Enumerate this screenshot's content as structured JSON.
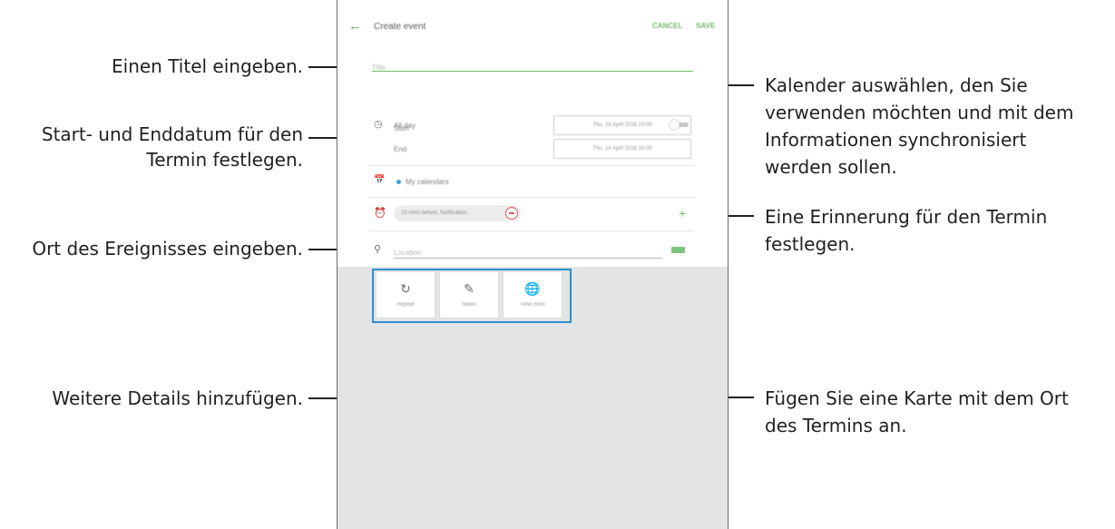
{
  "annotations": {
    "title": "Einen Titel eingeben.",
    "dates_line1": "Start- und Enddatum für den",
    "dates_line2": "Termin festlegen.",
    "location": "Ort des Ereignisses eingeben.",
    "details": "Weitere Details hinzufügen.",
    "calendar_line1": "Kalender auswählen, den Sie",
    "calendar_line2": "verwenden möchten und mit dem",
    "calendar_line3": "Informationen synchronisiert",
    "calendar_line4": "werden sollen.",
    "reminder_line1": "Eine Erinnerung für den Termin",
    "reminder_line2": "festlegen.",
    "map_line1": "Fügen Sie eine Karte mit dem Ort",
    "map_line2": "des Termins an."
  },
  "screen": {
    "appbar": {
      "title": "Create event",
      "cancel": "CANCEL",
      "save": "SAVE"
    },
    "title_placeholder": "Title",
    "all_day": "All day",
    "start_label": "Start",
    "end_label": "End",
    "start_value": "Thu, 14 April 2016   10:00",
    "end_value": "Thu, 14 April 2016   16:00",
    "calendar": "My calendars",
    "reminder": "10 mins before, Notification",
    "location_placeholder": "Location",
    "tiles": [
      {
        "label": "Repeat",
        "icon": "repeat-icon"
      },
      {
        "label": "Notes",
        "icon": "notes-icon"
      },
      {
        "label": "Time zone",
        "icon": "time-zone-icon"
      }
    ]
  },
  "colors": {
    "accent_green": "#6ec06a",
    "highlight_blue": "#2b8fcd",
    "calendar_dot": "#3a9fd9"
  }
}
